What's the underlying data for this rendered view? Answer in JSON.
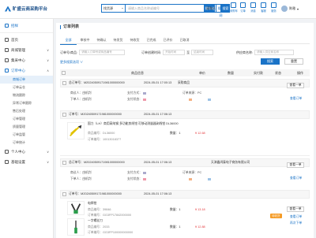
{
  "header": {
    "logo_text": "旷盛云商采购平台",
    "search_type": "找货源",
    "search_placeholder": "请输入商品名称或编号",
    "search_btn": "搜本站",
    "search_btn2": "搜全网",
    "search2_value": "采购人",
    "search2_btn": "搜索",
    "icons": [
      {
        "name": "cart-icon",
        "label": "采购车"
      },
      {
        "name": "order-icon",
        "label": "订单"
      },
      {
        "name": "message-icon",
        "label": "消息"
      },
      {
        "name": "service-icon",
        "label": "客服"
      },
      {
        "name": "grid-icon",
        "label": "服务"
      }
    ],
    "username": "陈雅"
  },
  "sidebar": {
    "sections": [
      {
        "label": "招样",
        "icon": "home-icon",
        "active": true
      },
      {
        "label": "首页",
        "icon": "home-icon"
      },
      {
        "label": "商城管理",
        "icon": "store-icon",
        "caret": "v"
      },
      {
        "label": "集采中心",
        "icon": "center-icon",
        "caret": "v"
      },
      {
        "label": "订单中心",
        "icon": "order-icon",
        "caret": "^",
        "active": true
      }
    ],
    "items": [
      "商城订单",
      "订单云仓",
      "物流跟踪",
      "异常订单跟踪",
      "售后处理",
      "订单管理",
      "质量管理",
      "订单监管",
      "订单统计"
    ],
    "bottom": [
      {
        "label": "个人中心",
        "icon": "user-icon"
      },
      {
        "label": "基础设置",
        "icon": "settings-icon"
      }
    ]
  },
  "main": {
    "title": "订单列表",
    "tabs": [
      "全部",
      "审核中",
      "待确认",
      "待发货",
      "待收货",
      "已完成",
      "已评价",
      "已取消"
    ],
    "filter": {
      "order_no_label": "订单号/商品:",
      "order_no_placeholder": "请输入订单号或商品编号",
      "date_label": "订单创建时间:",
      "date_start": "开始时间",
      "date_sep": "至",
      "date_end": "结束时间",
      "supplier_label": "供应商名称:",
      "supplier_placeholder": "请输入供应商名称"
    },
    "more": "更多搜索选项 ∨",
    "search_btn": "搜索",
    "reset_btn": "重置",
    "table_head": {
      "goods": "商品信息",
      "price": "单价",
      "qty": "数量",
      "total": "实付款",
      "status": "状态",
      "ops": "操作"
    },
    "orders": [
      {
        "order_no": "总订单号：M20240509171981000000000",
        "time": "2024-05-01 17:00:13",
        "shop": "采购商品",
        "detail_btn": "查看一单",
        "f1_label": "商议人：",
        "f1_val": "由机判",
        "f1b_label": "支付方式：",
        "f1c_label": "订单来源：",
        "f1c_val": "PC",
        "f2_label": "下单人：",
        "f2_val": "由机判",
        "f2b_label": "支付状态：",
        "link": "查看订单"
      },
      {
        "order_no": "订单号：M20240509171981000000000",
        "time": "2024-05-01 17:06:13",
        "status_txt": "待收货",
        "product": {
          "name": "国力（LH）商用高纯钢 多功能剪线钳 可移动测量器剥线钳 DL36000",
          "code": "商品编号：DL36000",
          "spec": "订单编号：10013018377",
          "price": "¥ 12.68",
          "qty": "数量：1",
          "total": "¥ 12.68"
        }
      },
      {
        "order_no": "总订单号：M20240509171981000000000",
        "time": "2024-05-01 17:06:13",
        "shop": "天津鑫鸿泰电子商务有限公司",
        "detail_btn": "查看一单",
        "f1_label": "商议人：",
        "f1_val": "由机判",
        "f1b_label": "支付方式：",
        "f1c_label": "订单来源：",
        "f1c_val": "PC",
        "f2_label": "下单人：",
        "f2_val": "由机判",
        "f2b_label": "支付状态：",
        "link": "查看订单"
      },
      {
        "order_no": "订单号：M20240509171981000000000",
        "time": "2024-05-01 17:06:13",
        "products": [
          {
            "name": "电焊钳",
            "code": "商品编号：39846",
            "spec": "订单编号：GG3FP17842000000",
            "price": "¥ 13.18",
            "qty": "数量：1",
            "total": "¥ 13.18",
            "btn": "查看一单"
          },
          {
            "name": "一字螺丝刀",
            "code": "商品编号：2033",
            "spec": "订单编号：GG3FP100000000000",
            "price": "¥ 12.88",
            "qty": "数量：1",
            "total": "¥ 12.88",
            "tag": "待收货",
            "link": "查看订单",
            "link2": "再次下单"
          }
        ]
      }
    ]
  }
}
